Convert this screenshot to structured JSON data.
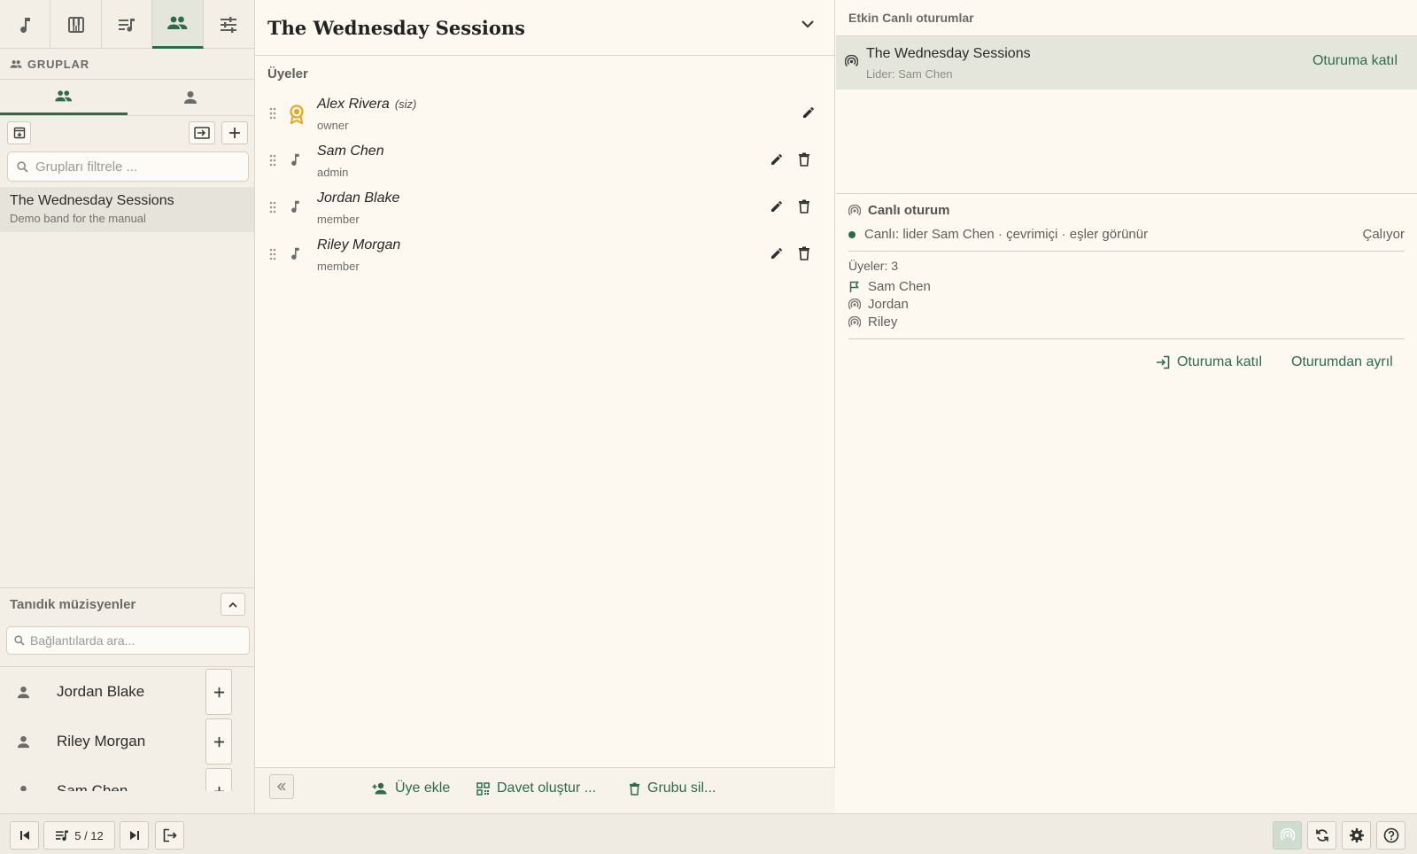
{
  "left": {
    "top_tabs": [
      {
        "icon": "music-note-icon",
        "active": false
      },
      {
        "icon": "piano-icon",
        "active": false
      },
      {
        "icon": "playlist-icon",
        "active": false
      },
      {
        "icon": "groups-icon",
        "active": true
      },
      {
        "icon": "tune-icon",
        "active": false
      }
    ],
    "section_title": "GRUPLAR",
    "filter_placeholder": "Grupları filtrele ...",
    "groups": [
      {
        "name": "The Wednesday Sessions",
        "description": "Demo band for the manual"
      }
    ],
    "musicians_title": "Tanıdık müzisyenler",
    "musicians_search_placeholder": "Bağlantılarda ara...",
    "musicians": [
      "Jordan Blake",
      "Riley Morgan",
      "Sam Chen"
    ]
  },
  "middle": {
    "title": "The Wednesday Sessions",
    "members_label": "Üyeler",
    "members": [
      {
        "name": "Alex Rivera",
        "you": "(siz)",
        "role": "owner"
      },
      {
        "name": "Sam Chen",
        "role": "admin"
      },
      {
        "name": "Jordan Blake",
        "role": "member"
      },
      {
        "name": "Riley Morgan",
        "role": "member"
      }
    ],
    "footer": {
      "add_member": "Üye ekle",
      "create_invite": "Davet oluştur ...",
      "delete_group": "Grubu sil..."
    }
  },
  "right": {
    "active_title": "Etkin Canlı oturumlar",
    "session": {
      "name": "The Wednesday Sessions",
      "leader": "Lider: Sam Chen",
      "join": "Oturuma katıl"
    },
    "live": {
      "title": "Canlı oturum",
      "status": "Canlı: lider Sam Chen  ·  çevrimiçi · eşler görünür",
      "state": "Çalıyor",
      "members_count": "Üyeler: 3",
      "members": [
        {
          "name": "Sam Chen",
          "icon": "flag-icon"
        },
        {
          "name": "Jordan",
          "icon": "broadcast-icon"
        },
        {
          "name": "Riley",
          "icon": "broadcast-icon"
        }
      ],
      "join": "Oturuma katıl",
      "leave": "Oturumdan ayrıl"
    }
  },
  "bottom": {
    "counter": "5 / 12"
  },
  "colors": {
    "accent": "#2f6b4a",
    "owner_badge": "#e8a51d",
    "background": "#fdf8f0",
    "sidebar": "#f3efe6"
  }
}
